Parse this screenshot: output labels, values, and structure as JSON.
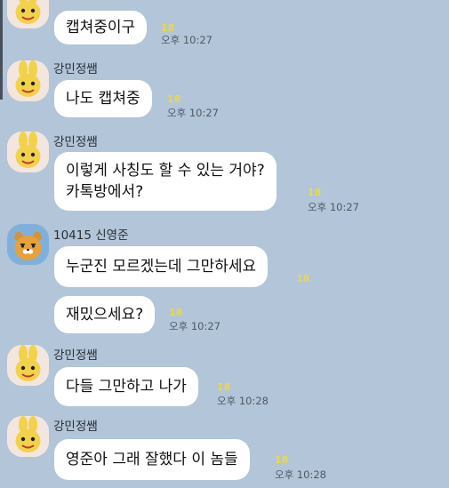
{
  "messages": [
    {
      "sender": "",
      "text": "캡쳐중이구",
      "unread": "18",
      "time": "오후 10:27"
    },
    {
      "sender": "강민정쌤",
      "text": "나도 캡쳐중",
      "unread": "18",
      "time": "오후 10:27"
    },
    {
      "sender": "강민정쌤",
      "lines": [
        "이렇게 사칭도 할 수 있는 거야?",
        "카톡방에서?"
      ],
      "unread": "18",
      "time": "오후 10:27"
    },
    {
      "sender": "10415 신영준",
      "text": "누군진 모르겠는데 그만하세요",
      "unread": "18",
      "time": ""
    },
    {
      "sender": "",
      "text": "재밌으세요?",
      "unread": "18",
      "time": "오후 10:27"
    },
    {
      "sender": "강민정쌤",
      "text": "다들 그만하고 나가",
      "unread": "18",
      "time": "오후 10:28"
    },
    {
      "sender": "강민정쌤",
      "text": "영준아 그래 잘했다 이 놈들",
      "unread": "18",
      "time": "오후 10:28"
    }
  ],
  "icons": {
    "rabbit_avatar": "muzi-rabbit-icon",
    "lion_avatar": "ryan-lion-icon"
  },
  "colors": {
    "background": "#b3c5d8",
    "bubble": "#ffffff",
    "unread": "#e9d84f",
    "time": "#4f5a66"
  }
}
